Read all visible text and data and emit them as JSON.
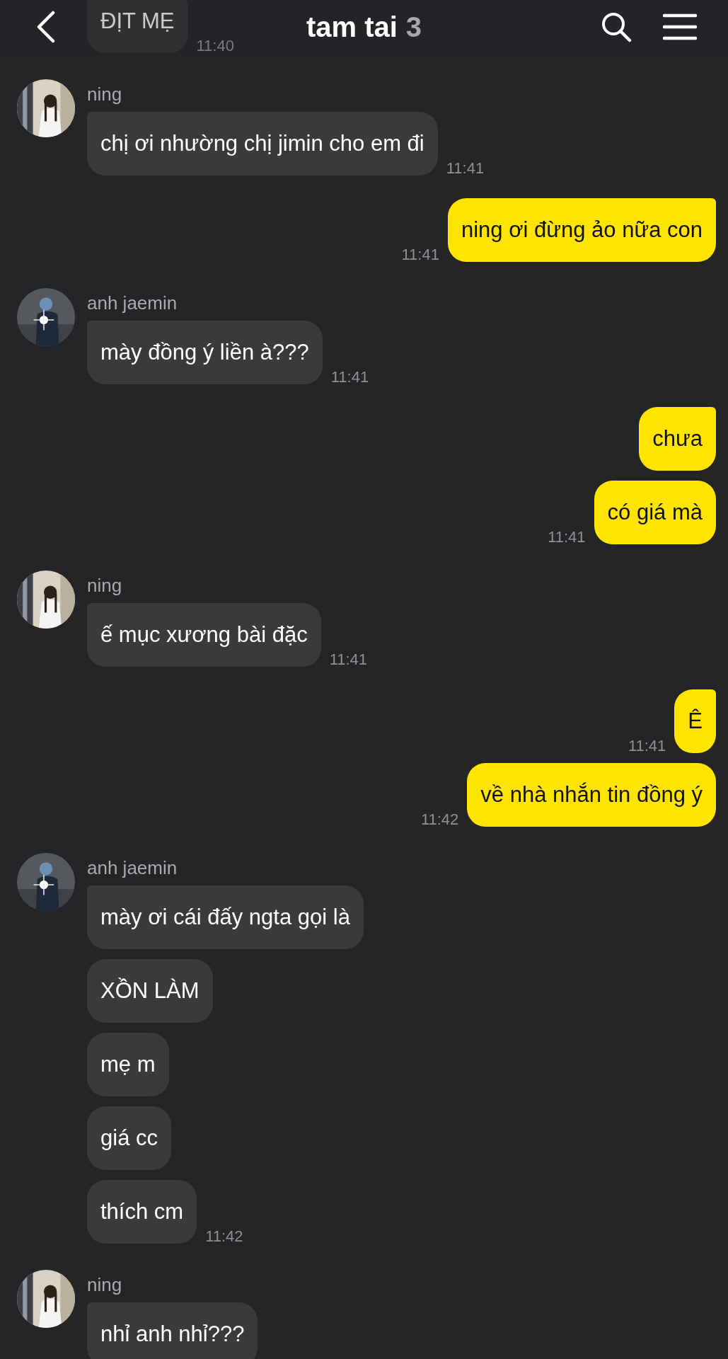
{
  "header": {
    "title": "tam tai",
    "member_count": "3"
  },
  "groups": [
    {
      "kind": "incoming",
      "messages": [
        {
          "text": "ĐỊT MẸ",
          "time": "11:40"
        }
      ]
    },
    {
      "kind": "incoming",
      "sender": "ning",
      "messages": [
        {
          "text": "chị ơi nhường chị jimin cho em đi",
          "time": "11:41"
        }
      ]
    },
    {
      "kind": "outgoing",
      "messages": [
        {
          "text": "ning ơi đừng ảo nữa con",
          "time": "11:41"
        }
      ]
    },
    {
      "kind": "incoming",
      "sender": "anh jaemin",
      "messages": [
        {
          "text": "mày đồng ý liền à???",
          "time": "11:41"
        }
      ]
    },
    {
      "kind": "outgoing",
      "messages": [
        {
          "text": "chưa"
        },
        {
          "text": "có giá mà",
          "time": "11:41"
        }
      ]
    },
    {
      "kind": "incoming",
      "sender": "ning",
      "messages": [
        {
          "text": "ế mục xương bài đặc",
          "time": "11:41"
        }
      ]
    },
    {
      "kind": "outgoing",
      "messages": [
        {
          "text": "Ê",
          "time": "11:41"
        },
        {
          "text": "về nhà nhắn tin đồng ý",
          "time": "11:42"
        }
      ]
    },
    {
      "kind": "incoming",
      "sender": "anh jaemin",
      "messages": [
        {
          "text": "mày ơi cái đấy ngta gọi là"
        },
        {
          "text": "XỒN LÀM"
        },
        {
          "text": "mẹ m"
        },
        {
          "text": "giá cc"
        },
        {
          "text": "thích cm",
          "time": "11:42"
        }
      ]
    },
    {
      "kind": "incoming",
      "sender": "ning",
      "messages": [
        {
          "text": "nhỉ anh nhỉ???"
        }
      ]
    }
  ]
}
